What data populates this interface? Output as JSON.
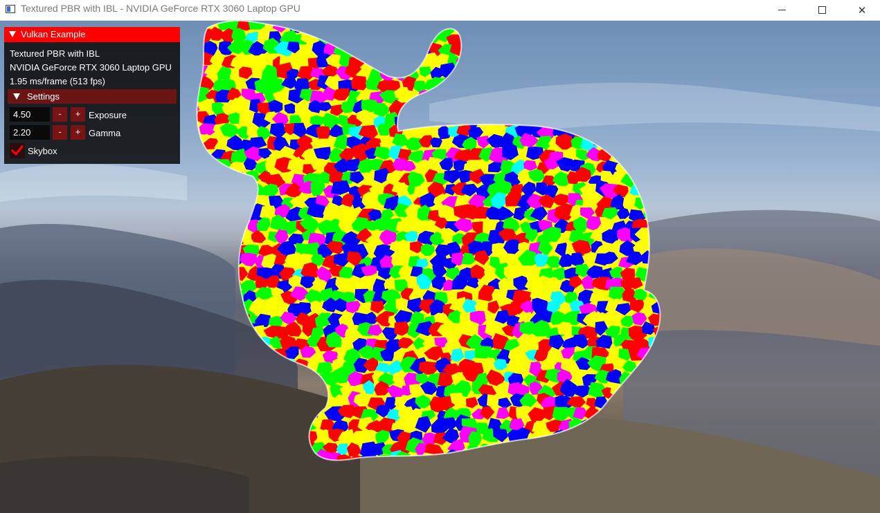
{
  "window": {
    "title": "Textured PBR with IBL - NVIDIA GeForce RTX 3060 Laptop GPU",
    "close_glyph": "✕"
  },
  "overlay": {
    "header": "Vulkan Example",
    "app_name": "Textured PBR with IBL",
    "gpu": "NVIDIA GeForce RTX 3060 Laptop GPU",
    "timing": "1.95 ms/frame (513 fps)",
    "settings_label": "Settings",
    "exposure": {
      "value": "4.50",
      "label": "Exposure",
      "minus": "-",
      "plus": "+"
    },
    "gamma": {
      "value": "2.20",
      "label": "Gamma",
      "minus": "-",
      "plus": "+"
    },
    "skybox": {
      "label": "Skybox",
      "checked": true
    }
  },
  "colors": {
    "header_bg": "#ff0000",
    "button_bg": "#7a1313",
    "section_bg": "#6b1414",
    "check_color": "#ff0000",
    "patch_palette": [
      "#ff0000",
      "#00ff00",
      "#0000ff",
      "#ffff00",
      "#ff00ff",
      "#00ffff"
    ]
  },
  "icons": [
    "app-icon",
    "minimize-icon",
    "maximize-icon",
    "close-icon",
    "collapse-triangle-icon",
    "checkmark-icon"
  ]
}
